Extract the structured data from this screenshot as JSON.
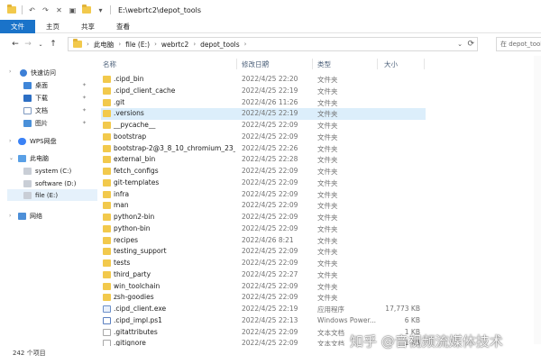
{
  "window": {
    "title": "E:\\webrtc2\\depot_tools"
  },
  "ribbon": {
    "tabs": [
      "文件",
      "主页",
      "共享",
      "查看"
    ]
  },
  "address": {
    "crumbs": [
      "此电脑",
      "file (E:)",
      "webrtc2",
      "depot_tools"
    ],
    "search_placeholder": "在 depot_tools"
  },
  "nav": {
    "items": [
      {
        "label": "快速访问",
        "kind": "star",
        "y": 0
      },
      {
        "label": "桌面",
        "kind": "desktop",
        "y": 1
      },
      {
        "label": "下载",
        "kind": "download",
        "y": 2
      },
      {
        "label": "文档",
        "kind": "doc",
        "y": 3
      },
      {
        "label": "图片",
        "kind": "pic",
        "y": 4
      },
      {
        "label": "WPS网盘",
        "kind": "cloud",
        "y": 5
      },
      {
        "label": "此电脑",
        "kind": "pc",
        "y": 6
      },
      {
        "label": "system (C:)",
        "kind": "drive",
        "y": 7
      },
      {
        "label": "software (D:)",
        "kind": "drive",
        "y": 8
      },
      {
        "label": "file (E:)",
        "kind": "drive",
        "y": 9
      },
      {
        "label": "网络",
        "kind": "net",
        "y": 10
      }
    ]
  },
  "columns": {
    "name": "名称",
    "date": "修改日期",
    "type": "类型",
    "size": "大小"
  },
  "files": [
    {
      "name": ".cipd_bin",
      "date": "2022/4/25 22:20",
      "type": "文件夹",
      "size": "",
      "kind": "folder"
    },
    {
      "name": ".cipd_client_cache",
      "date": "2022/4/25 22:19",
      "type": "文件夹",
      "size": "",
      "kind": "folder"
    },
    {
      "name": ".git",
      "date": "2022/4/26 11:26",
      "type": "文件夹",
      "size": "",
      "kind": "folder"
    },
    {
      "name": ".versions",
      "date": "2022/4/25 22:19",
      "type": "文件夹",
      "size": "",
      "kind": "folder",
      "highlight": true
    },
    {
      "name": "__pycache__",
      "date": "2022/4/25 22:09",
      "type": "文件夹",
      "size": "",
      "kind": "folder"
    },
    {
      "name": "bootstrap",
      "date": "2022/4/25 22:09",
      "type": "文件夹",
      "size": "",
      "kind": "folder"
    },
    {
      "name": "bootstrap-2@3_8_10_chromium_23_...",
      "date": "2022/4/25 22:26",
      "type": "文件夹",
      "size": "",
      "kind": "folder"
    },
    {
      "name": "external_bin",
      "date": "2022/4/25 22:28",
      "type": "文件夹",
      "size": "",
      "kind": "folder"
    },
    {
      "name": "fetch_configs",
      "date": "2022/4/25 22:09",
      "type": "文件夹",
      "size": "",
      "kind": "folder"
    },
    {
      "name": "git-templates",
      "date": "2022/4/25 22:09",
      "type": "文件夹",
      "size": "",
      "kind": "folder"
    },
    {
      "name": "infra",
      "date": "2022/4/25 22:09",
      "type": "文件夹",
      "size": "",
      "kind": "folder"
    },
    {
      "name": "man",
      "date": "2022/4/25 22:09",
      "type": "文件夹",
      "size": "",
      "kind": "folder"
    },
    {
      "name": "python2-bin",
      "date": "2022/4/25 22:09",
      "type": "文件夹",
      "size": "",
      "kind": "folder"
    },
    {
      "name": "python-bin",
      "date": "2022/4/25 22:09",
      "type": "文件夹",
      "size": "",
      "kind": "folder"
    },
    {
      "name": "recipes",
      "date": "2022/4/26 8:21",
      "type": "文件夹",
      "size": "",
      "kind": "folder"
    },
    {
      "name": "testing_support",
      "date": "2022/4/25 22:09",
      "type": "文件夹",
      "size": "",
      "kind": "folder"
    },
    {
      "name": "tests",
      "date": "2022/4/25 22:09",
      "type": "文件夹",
      "size": "",
      "kind": "folder"
    },
    {
      "name": "third_party",
      "date": "2022/4/25 22:27",
      "type": "文件夹",
      "size": "",
      "kind": "folder"
    },
    {
      "name": "win_toolchain",
      "date": "2022/4/25 22:09",
      "type": "文件夹",
      "size": "",
      "kind": "folder"
    },
    {
      "name": "zsh-goodies",
      "date": "2022/4/25 22:09",
      "type": "文件夹",
      "size": "",
      "kind": "folder"
    },
    {
      "name": ".cipd_client.exe",
      "date": "2022/4/25 22:19",
      "type": "应用程序",
      "size": "17,773 KB",
      "kind": "exe"
    },
    {
      "name": ".cipd_impl.ps1",
      "date": "2022/4/25 22:13",
      "type": "Windows Power...",
      "size": "6 KB",
      "kind": "ps1"
    },
    {
      "name": ".gitattributes",
      "date": "2022/4/25 22:09",
      "type": "文本文档",
      "size": "1 KB",
      "kind": "file"
    },
    {
      "name": ".gitignore",
      "date": "2022/4/25 22:09",
      "type": "文本文档",
      "size": "1 KB",
      "kind": "file"
    }
  ],
  "status": {
    "count": "242 个项目"
  },
  "watermark": "知乎 @音视频流媒体技术",
  "colors": {
    "accent": "#1a73c9",
    "folder": "#f2c94c",
    "highlight": "#dceefb"
  }
}
